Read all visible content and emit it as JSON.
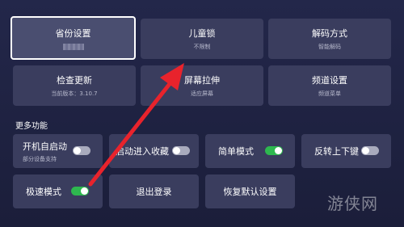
{
  "top_row": [
    {
      "title": "省份设置",
      "sub": ""
    },
    {
      "title": "儿童锁",
      "sub": "不限制"
    },
    {
      "title": "解码方式",
      "sub": "智能解码"
    }
  ],
  "second_row": [
    {
      "title": "检查更新",
      "sub": "当前版本：3.10.7"
    },
    {
      "title": "屏幕拉伸",
      "sub": "适应屏幕"
    },
    {
      "title": "频道设置",
      "sub": "频道菜单"
    }
  ],
  "more_section": {
    "title": "更多功能"
  },
  "toggles": [
    {
      "label": "开机自启动",
      "sub": "部分设备支持",
      "state": "off"
    },
    {
      "label": "启动进入收藏",
      "state": "off"
    },
    {
      "label": "简单模式",
      "state": "on"
    },
    {
      "label": "反转上下键",
      "state": "off"
    }
  ],
  "bottom_row": [
    {
      "label": "极速模式",
      "state": "on"
    },
    {
      "label": "退出登录"
    },
    {
      "label": "恢复默认设置"
    }
  ],
  "watermark": "游侠网",
  "colors": {
    "toggle_on": "#2eb84f",
    "arrow": "#e8232c",
    "tile": "#3a3d5e"
  }
}
